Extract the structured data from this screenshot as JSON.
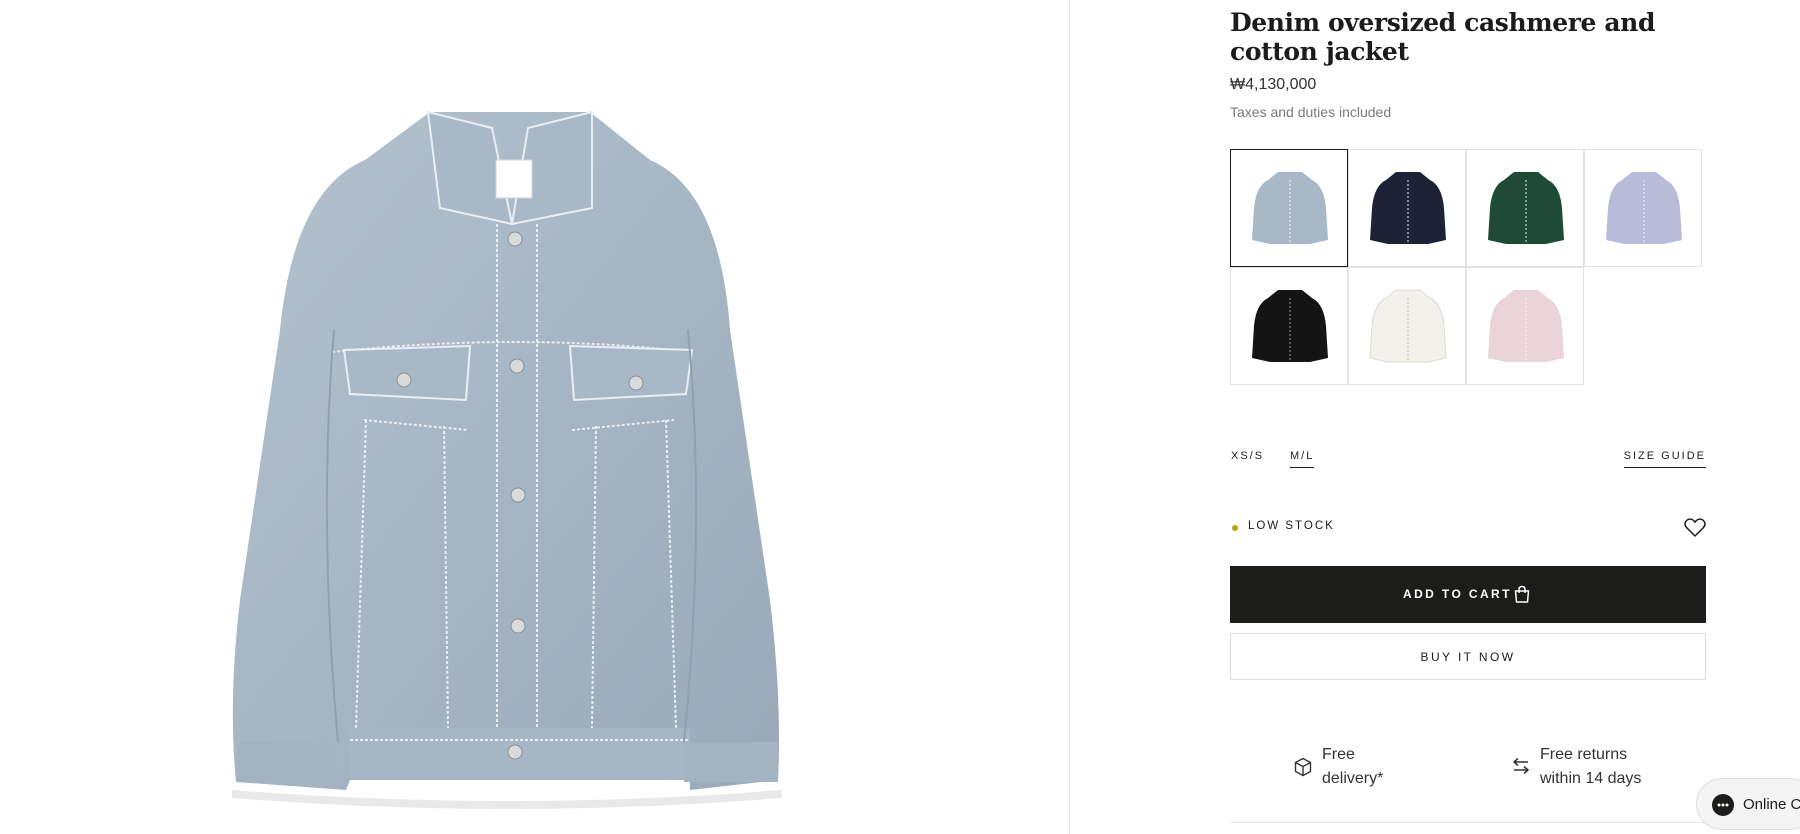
{
  "product": {
    "title": "Denim oversized cashmere and cotton jacket",
    "price": "₩4,130,000",
    "tax_note": "Taxes and duties included"
  },
  "swatches": [
    {
      "name": "light-blue",
      "color": "#a9b8c6",
      "selected": true
    },
    {
      "name": "navy",
      "color": "#1d2236"
    },
    {
      "name": "green",
      "color": "#1f4a37"
    },
    {
      "name": "lavender",
      "color": "#b9bcd9"
    },
    {
      "name": "black",
      "color": "#141414"
    },
    {
      "name": "white",
      "color": "#f3f1ec"
    },
    {
      "name": "pink",
      "color": "#ead3d9"
    }
  ],
  "sizes": {
    "options": [
      "XS/S",
      "M/L"
    ],
    "selected": "M/L",
    "guide_label": "SIZE GUIDE"
  },
  "stock": {
    "label": "LOW STOCK",
    "dot_color": "#c49b12"
  },
  "actions": {
    "add_to_cart": "ADD TO CART",
    "buy_now": "BUY IT NOW"
  },
  "perks": [
    {
      "icon": "box-icon",
      "line1": "Free",
      "line2": "delivery*"
    },
    {
      "icon": "exchange-arrows-icon",
      "line1": "Free returns",
      "line2": "within 14 days"
    }
  ],
  "chat": {
    "label": "Online C"
  }
}
